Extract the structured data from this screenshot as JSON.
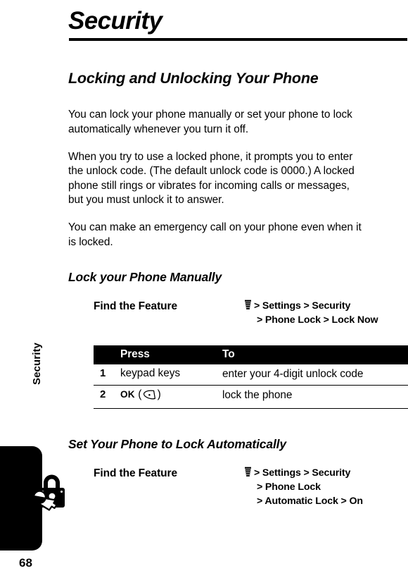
{
  "document": {
    "chapter_title": "Security",
    "page_number": "68",
    "running_head": "Security"
  },
  "icons": {
    "menu": "menu-key-icon",
    "softkey": "left-softkey-icon",
    "lock": "padlock-and-key-icon"
  },
  "sections": [
    {
      "heading": "Locking and Unlocking Your Phone",
      "paragraphs": [
        "You can lock your phone manually or set your phone to lock automatically whenever you turn it off.",
        "When you try to use a locked phone, it prompts you to enter the unlock code. (The default unlock code is 0000.) A locked phone still rings or vibrates for incoming calls or messages, but you must unlock it to answer.",
        "You can make an emergency call on your phone even when it is locked."
      ]
    }
  ],
  "subsection_1": {
    "heading": "Lock your Phone Manually",
    "find_the_feature": {
      "label": "Find the Feature",
      "lines": [
        "> Settings > Security",
        "> Phone Lock > Lock Now"
      ]
    },
    "table": {
      "headers": [
        "",
        "Press",
        "To"
      ],
      "rows": [
        {
          "num": "1",
          "press": "keypad keys",
          "press_softkey": "",
          "to": "enter your 4-digit unlock code"
        },
        {
          "num": "2",
          "press": "OK",
          "press_softkey": "(+)",
          "to": "lock the phone"
        }
      ]
    }
  },
  "subsection_2": {
    "heading": "Set Your Phone to Lock Automatically",
    "find_the_feature": {
      "label": "Find the Feature",
      "lines": [
        "> Settings > Security",
        "> Phone Lock",
        "> Automatic Lock > On"
      ]
    }
  }
}
